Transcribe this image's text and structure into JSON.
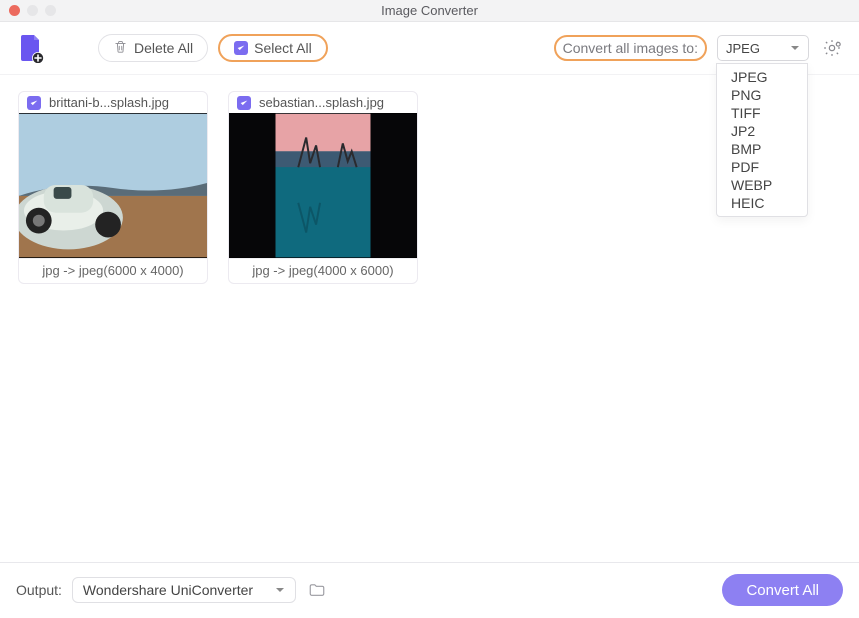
{
  "window": {
    "title": "Image Converter"
  },
  "toolbar": {
    "delete_all": "Delete All",
    "select_all": "Select All",
    "convert_to_label": "Convert all images to:",
    "format_selected": "JPEG",
    "format_options": [
      "JPEG",
      "PNG",
      "TIFF",
      "JP2",
      "BMP",
      "PDF",
      "WEBP",
      "HEIC"
    ]
  },
  "images": [
    {
      "filename": "brittani-b...splash.jpg",
      "meta": "jpg -> jpeg(6000 x 4000)"
    },
    {
      "filename": "sebastian...splash.jpg",
      "meta": "jpg -> jpeg(4000 x 6000)"
    }
  ],
  "footer": {
    "output_label": "Output:",
    "output_value": "Wondershare UniConverter",
    "convert_all": "Convert All"
  }
}
